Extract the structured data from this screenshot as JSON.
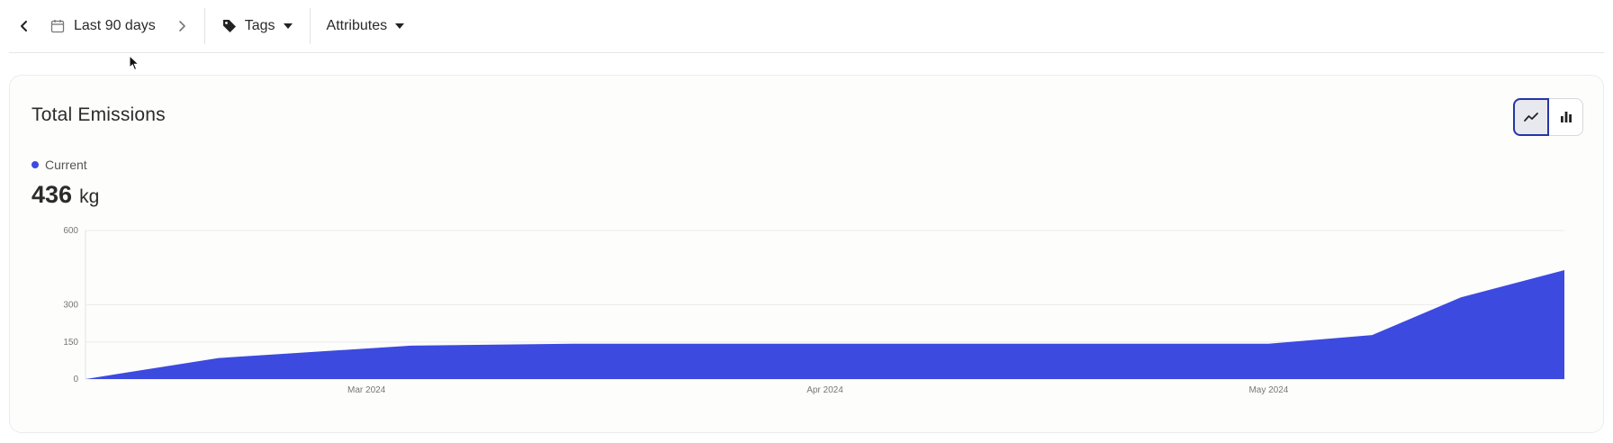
{
  "toolbar": {
    "date_range_label": "Last 90 days",
    "tags_label": "Tags",
    "attributes_label": "Attributes"
  },
  "card": {
    "title": "Total Emissions",
    "legend_label": "Current",
    "total_value": "436",
    "total_unit": "kg"
  },
  "colors": {
    "series": "#3c4ae0",
    "accent_outline": "#2535a8"
  },
  "chart_data": {
    "type": "area",
    "title": "",
    "xlabel": "",
    "ylabel": "",
    "ylim": [
      0,
      600
    ],
    "y_ticks": [
      0,
      150,
      300,
      600
    ],
    "x_tick_labels": [
      {
        "label": "Mar 2024",
        "date": "2024-03-01"
      },
      {
        "label": "Apr 2024",
        "date": "2024-04-01"
      },
      {
        "label": "May 2024",
        "date": "2024-05-01"
      }
    ],
    "x_range": [
      "2024-02-11",
      "2024-05-21"
    ],
    "grid": true,
    "series": [
      {
        "name": "Current",
        "x": [
          "2024-02-11",
          "2024-02-20",
          "2024-03-04",
          "2024-03-15",
          "2024-04-01",
          "2024-04-15",
          "2024-05-01",
          "2024-05-08",
          "2024-05-14",
          "2024-05-21"
        ],
        "y": [
          0,
          85,
          135,
          143,
          143,
          143,
          143,
          178,
          330,
          440
        ]
      }
    ]
  }
}
